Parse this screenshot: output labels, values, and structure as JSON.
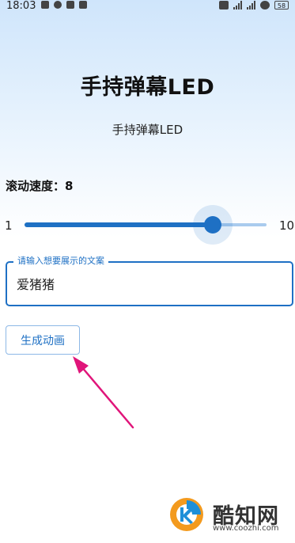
{
  "status_bar": {
    "time": "18:03",
    "battery": "58"
  },
  "app": {
    "title": "手持弹幕LED",
    "subtitle": "手持弹幕LED"
  },
  "speed": {
    "label": "滚动速度：8",
    "min_label": "1",
    "max_label": "10",
    "min": 1,
    "max": 10,
    "value": 8
  },
  "text_input": {
    "label": "请输入想要展示的文案",
    "value": "爱猪猪"
  },
  "generate_button": {
    "label": "生成动画"
  },
  "watermark": {
    "name": "酷知网",
    "url": "www.coozhi.com"
  },
  "colors": {
    "accent": "#1e70c4",
    "arrow": "#e0157a",
    "watermark_orange": "#f39a1e",
    "watermark_blue": "#1e8fd8"
  }
}
